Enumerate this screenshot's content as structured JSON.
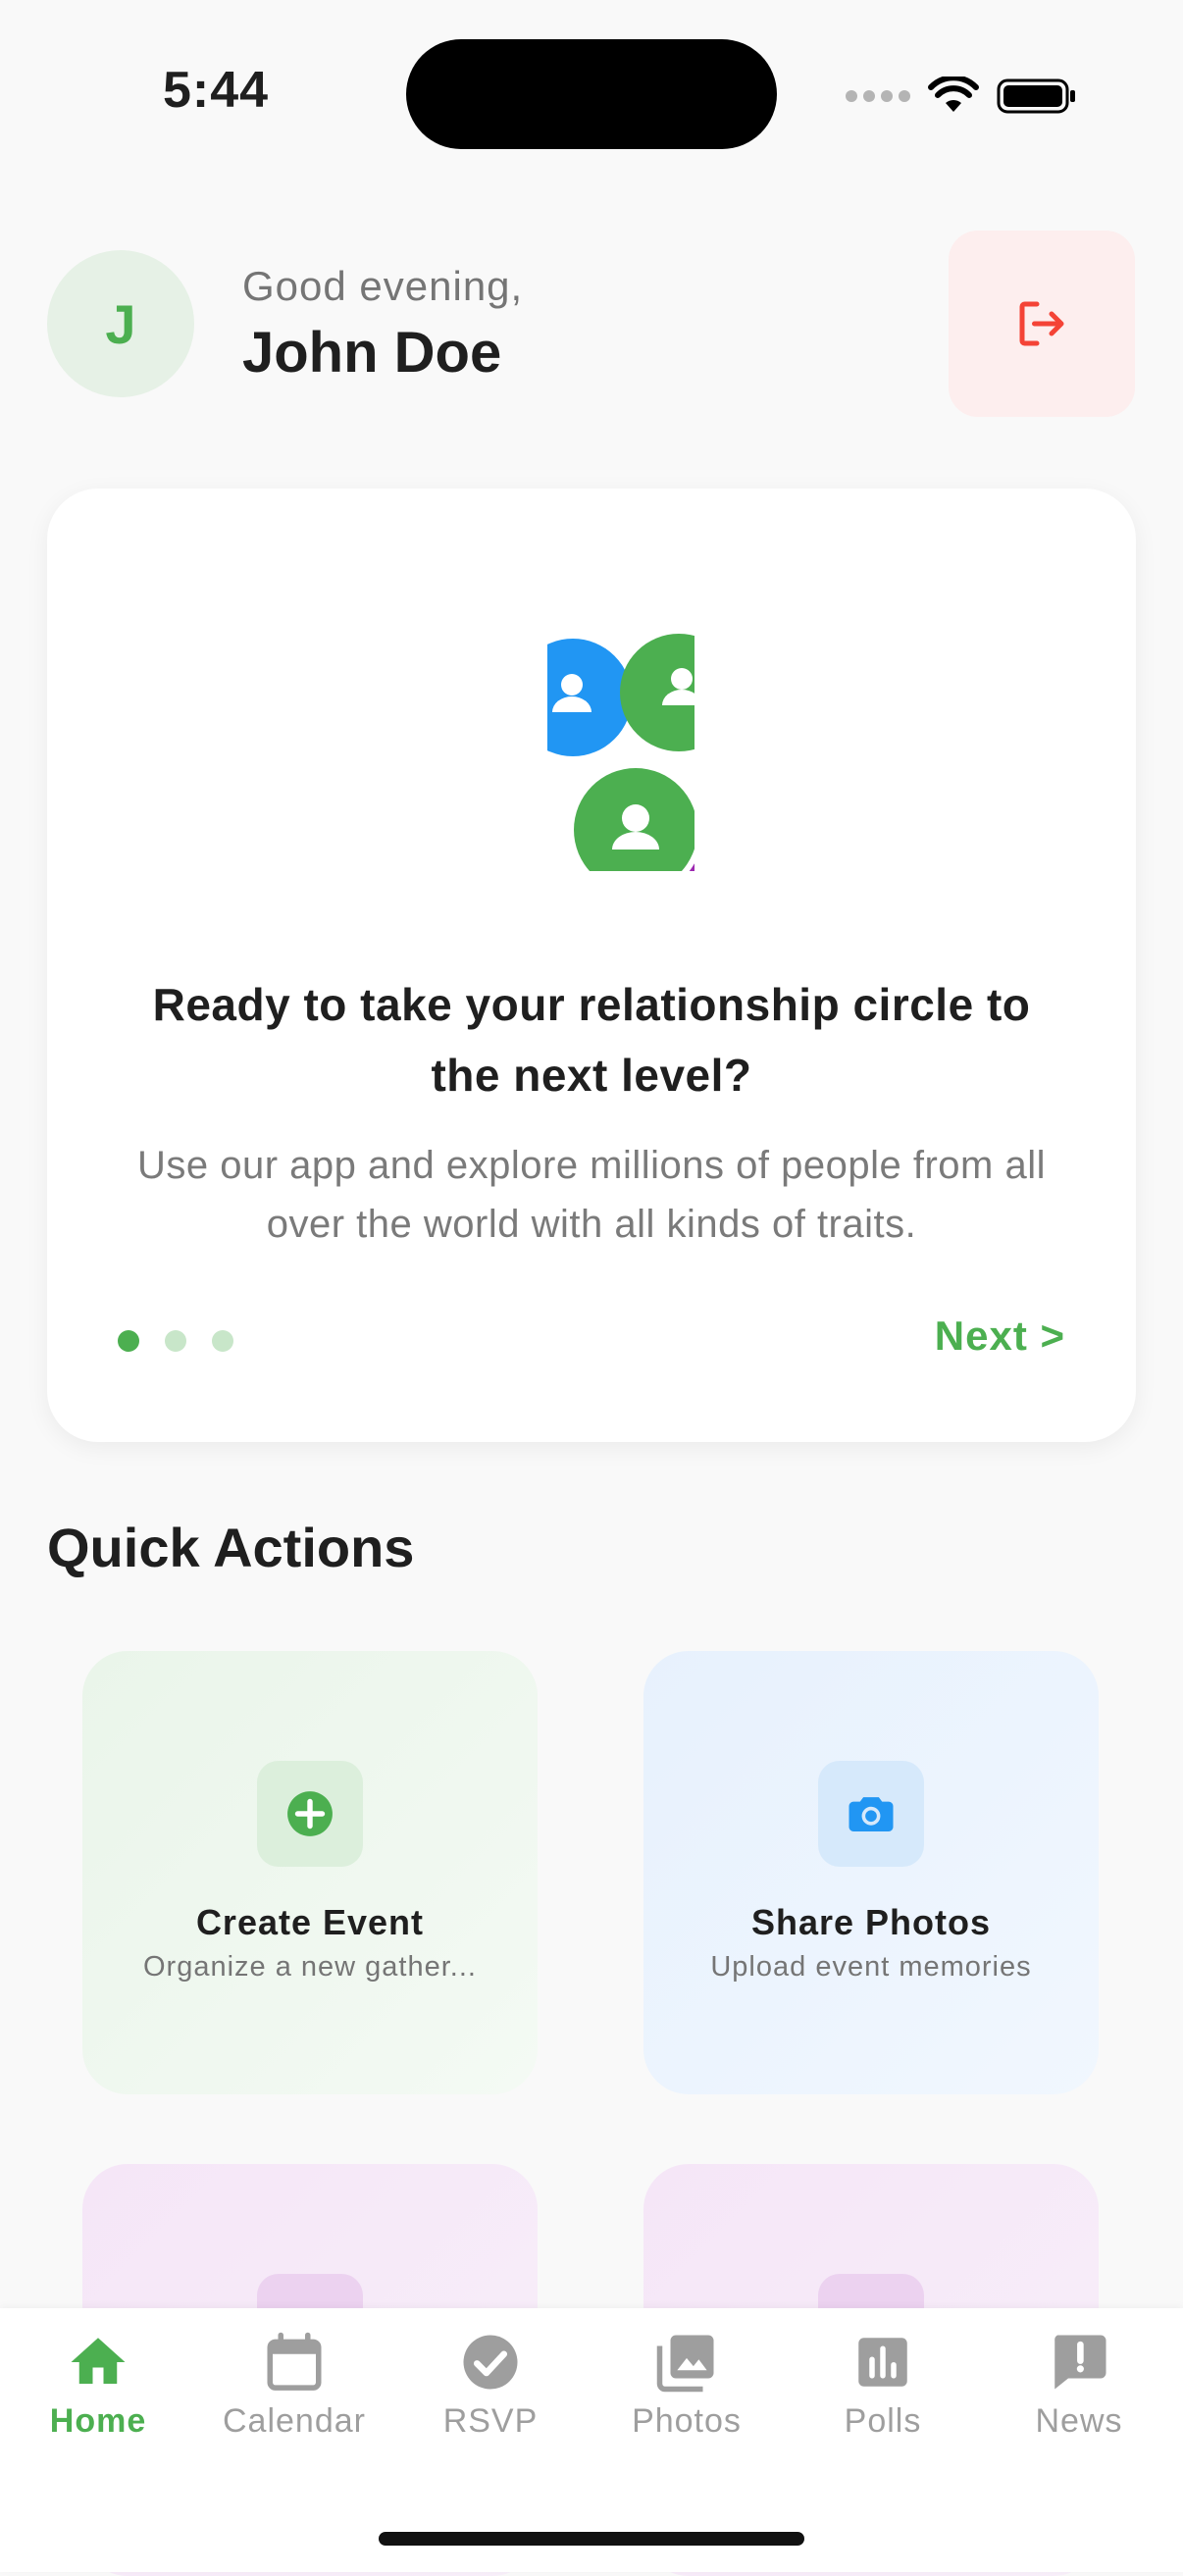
{
  "status_bar": {
    "time": "5:44"
  },
  "header": {
    "avatar_initial": "J",
    "greeting": "Good evening,",
    "user_name": "John Doe",
    "logout_icon": "logout-icon"
  },
  "onboarding": {
    "title": "Ready to take your relationship circle to the next level?",
    "description": "Use our app and explore millions of people from all over the world with all kinds of traits.",
    "page_count": 3,
    "active_page": 1,
    "next_label": "Next >"
  },
  "quick_actions": {
    "title": "Quick Actions",
    "items": [
      {
        "label": "Create Event",
        "subtitle": "Organize a new gather...",
        "icon": "add-circle-icon"
      },
      {
        "label": "Share Photos",
        "subtitle": "Upload event memories",
        "icon": "camera-icon"
      }
    ]
  },
  "bottom_nav": {
    "items": [
      {
        "label": "Home",
        "icon": "home-icon",
        "active": true
      },
      {
        "label": "Calendar",
        "icon": "calendar-icon"
      },
      {
        "label": "RSVP",
        "icon": "check-circle-icon"
      },
      {
        "label": "Photos",
        "icon": "photos-icon"
      },
      {
        "label": "Polls",
        "icon": "poll-icon"
      },
      {
        "label": "News",
        "icon": "news-icon"
      }
    ]
  },
  "colors": {
    "accent": "#4caf50",
    "danger": "#f44336",
    "blue": "#2196f3",
    "purple": "#9c27b0",
    "muted": "#9e9e9e"
  }
}
